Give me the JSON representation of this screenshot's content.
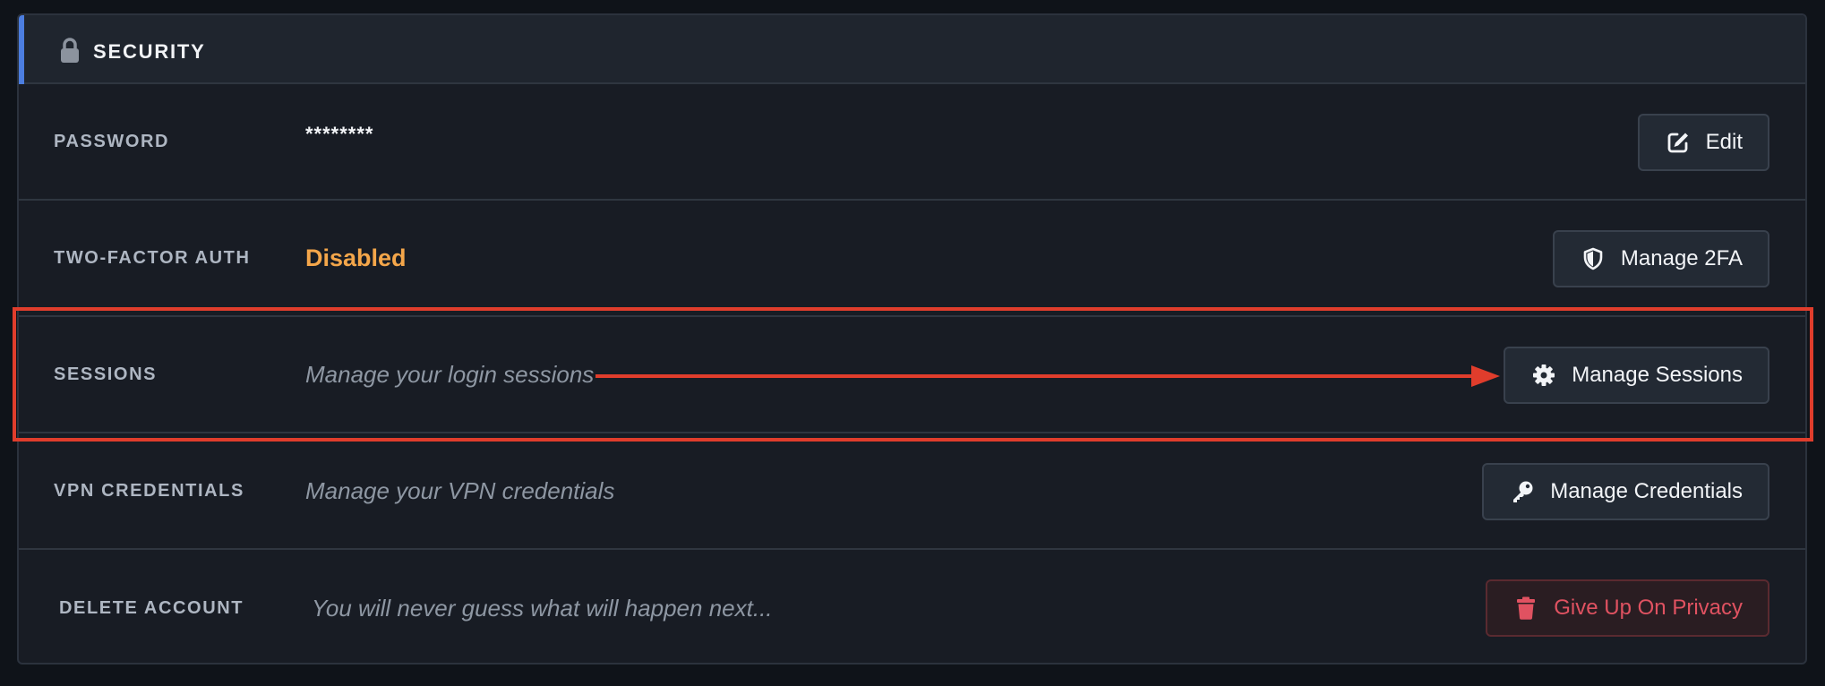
{
  "section": {
    "title": "SECURITY",
    "icon": "lock-icon"
  },
  "rows": [
    {
      "label": "PASSWORD",
      "value": "********",
      "button": {
        "label": "Edit",
        "icon": "edit-icon"
      }
    },
    {
      "label": "TWO-FACTOR AUTH",
      "value": "Disabled",
      "button": {
        "label": "Manage 2FA",
        "icon": "shield-icon"
      }
    },
    {
      "label": "SESSIONS",
      "value": "Manage your login sessions",
      "button": {
        "label": "Manage Sessions",
        "icon": "gear-icon"
      }
    },
    {
      "label": "VPN CREDENTIALS",
      "value": "Manage your VPN credentials",
      "button": {
        "label": "Manage Credentials",
        "icon": "key-icon"
      }
    },
    {
      "label": "DELETE ACCOUNT",
      "value": "You will never guess what will happen next...",
      "button": {
        "label": "Give Up On Privacy",
        "icon": "trash-icon"
      }
    }
  ],
  "colors": {
    "accent": "#4c7ee0",
    "status_disabled": "#f4a64a",
    "danger": "#e05261",
    "annotation": "#e03d2c"
  }
}
